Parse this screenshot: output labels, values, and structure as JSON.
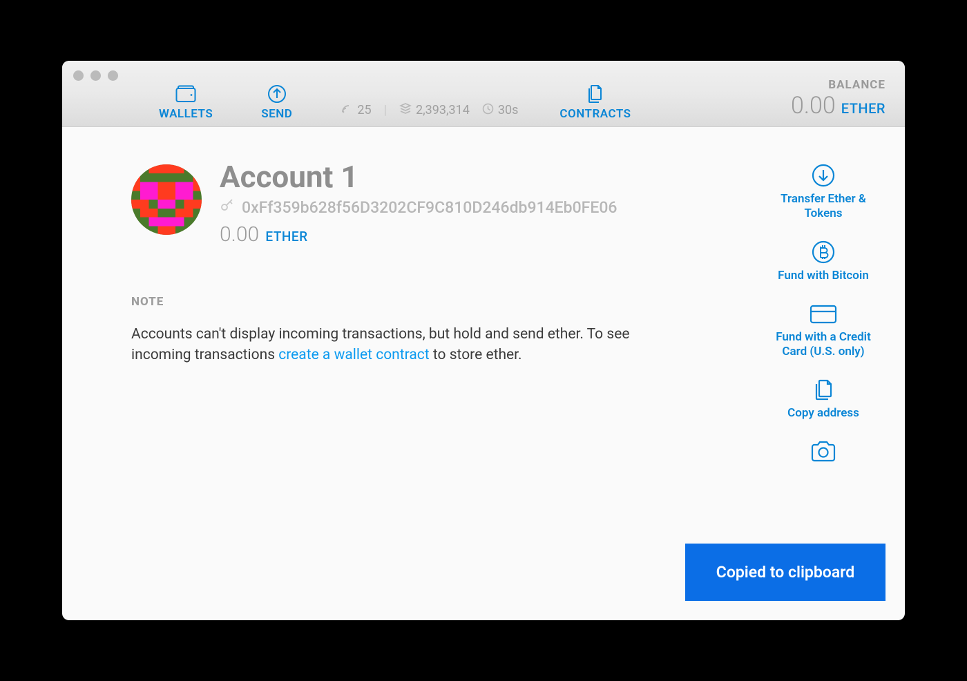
{
  "colors": {
    "accent": "#0b86d6",
    "toast": "#0b6ee6"
  },
  "nav": {
    "wallets": "WALLETS",
    "send": "SEND",
    "contracts": "CONTRACTS"
  },
  "stats": {
    "peers": "25",
    "block": "2,393,314",
    "sync": "30s"
  },
  "header_balance": {
    "label": "BALANCE",
    "amount": "0.00",
    "unit": "ETHER"
  },
  "account": {
    "name": "Account 1",
    "address": "0xFf359b628f56D3202CF9C810D246db914Eb0FE06",
    "balance_amount": "0.00",
    "balance_unit": "ETHER"
  },
  "note": {
    "heading": "NOTE",
    "text_before": "Accounts can't display incoming transactions, but hold and send ether. To see incoming transactions ",
    "link_text": "create a wallet contract",
    "text_after": " to store ether."
  },
  "side_actions": {
    "transfer": "Transfer Ether & Tokens",
    "fund_btc": "Fund with Bitcoin",
    "fund_card": "Fund with a Credit Card (U.S. only)",
    "copy": "Copy address",
    "qr": ""
  },
  "toast": "Copied to clipboard"
}
